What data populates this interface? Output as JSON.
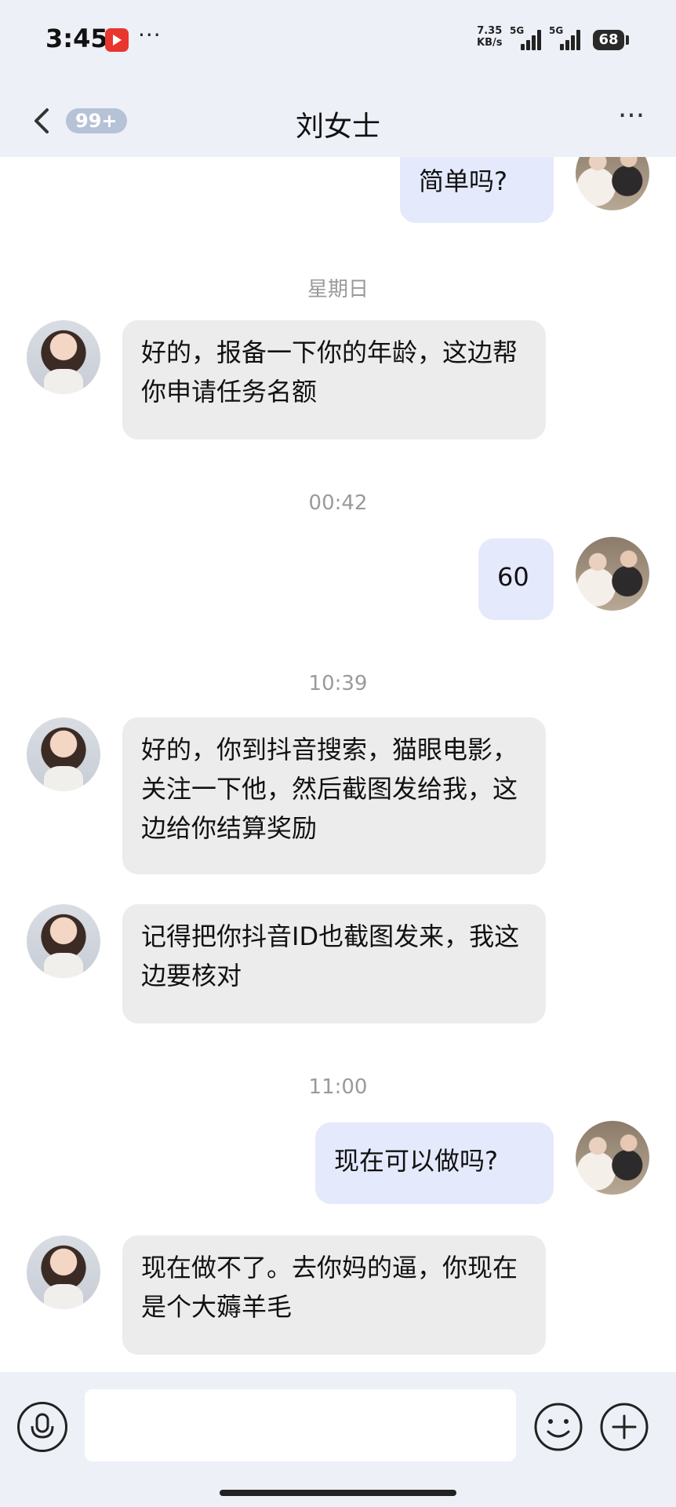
{
  "status_bar": {
    "time": "3:45",
    "more": "···",
    "net_speed_value": "7.35",
    "net_speed_unit": "KB/s",
    "sim1": "5G",
    "sim2": "5G",
    "battery": "68"
  },
  "nav": {
    "unread_count": "99+",
    "title": "刘女士",
    "more": "···"
  },
  "messages": [
    {
      "type": "text",
      "from": "self",
      "text": "简单吗?"
    },
    {
      "type": "time",
      "text": "星期日"
    },
    {
      "type": "text",
      "from": "agent",
      "text": "好的，报备一下你的年龄，这边帮你申请任务名额"
    },
    {
      "type": "time",
      "text": "00:42"
    },
    {
      "type": "text",
      "from": "self",
      "text": "60"
    },
    {
      "type": "time",
      "text": "10:39"
    },
    {
      "type": "text",
      "from": "agent",
      "text": "好的，你到抖音搜索，猫眼电影，关注一下他，然后截图发给我，这边给你结算奖励"
    },
    {
      "type": "text",
      "from": "agent",
      "text": "记得把你抖音ID也截图发来，我这边要核对"
    },
    {
      "type": "time",
      "text": "11:00"
    },
    {
      "type": "text",
      "from": "self",
      "text": "现在可以做吗?"
    },
    {
      "type": "text",
      "from": "agent",
      "text": "现在做不了。去你妈的逼，你现在是个大薅羊毛"
    }
  ],
  "input_bar": {
    "placeholder": "",
    "icons": [
      "microphone-icon",
      "emoji-icon",
      "plus-icon"
    ]
  },
  "colors": {
    "header_bg": "#edf0f7",
    "incoming_bubble": "#ececec",
    "outgoing_bubble": "#e4e9fb",
    "timestamp_text": "#9a9a9a"
  }
}
